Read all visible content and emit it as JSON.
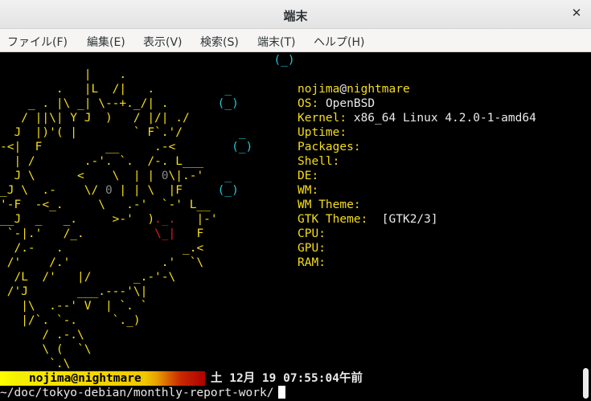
{
  "window": {
    "title": "端末",
    "close_glyph": "✕"
  },
  "menu": {
    "items": [
      "ファイル(F)",
      "編集(E)",
      "表示(V)",
      "検索(S)",
      "端末(T)",
      "ヘルプ(H)"
    ]
  },
  "art": {
    "top_dot": "(_)",
    "lines": [
      "            |    .",
      "        .   |L  /|   .          _",
      "    _ . |\\ _| \\--+._/| .       (_)",
      "   / ||\\| Y J  )   / |/| ./",
      "  J  |)'( |        ` F`.'/        _",
      "-<|  F         __     .-<        (_)",
      "  | /       .-'. `.  /-. L___",
      "  J \\      <    \\  | | 0\\|.-'   _",
      "_J \\  .-    \\/ 0 | | \\  |F     (_)",
      "'-F  -<_.     \\   .-'  `-' L__",
      "__J  _   _.     >-'  )._.   |-'",
      " `-|.'   /_.          \\_|   F",
      "  /.-   .                 _.<",
      " /'    /.'             .'  `\\",
      "  /L  /'   |/      _.-'-\\",
      " /'J       ___.---'\\|",
      "   |\\  .--' V  | `. `",
      "   |/`. `-.     `._)",
      "      / .-.\\",
      "      \\ (  `\\",
      "       `.\\"
    ]
  },
  "info": {
    "user": "nojima",
    "at": "@",
    "host": "nightmare",
    "os_label": "OS:",
    "os_value": "OpenBSD",
    "kernel_label": "Kernel:",
    "kernel_value": "x86_64 Linux 4.2.0-1-amd64",
    "uptime_label": "Uptime:",
    "packages_label": "Packages:",
    "shell_label": "Shell:",
    "de_label": "DE:",
    "wm_label": "WM:",
    "wmtheme_label": "WM Theme:",
    "gtktheme_label": "GTK Theme:",
    "gtktheme_value": "[GTK2/3]",
    "cpu_label": "CPU:",
    "gpu_label": "GPU:",
    "ram_label": "RAM:"
  },
  "status": {
    "name": "nojima@nightmare",
    "datetime": "土 12月 19 07:55:04午前"
  },
  "prompt": {
    "path": "~/doc/tokyo-debian/monthly-report-work/"
  },
  "colors": {
    "yellow": "#f5de1a",
    "cyan": "#24c6d4",
    "red": "#e01b24",
    "text": "#e9e9e9",
    "background": "#000000"
  }
}
